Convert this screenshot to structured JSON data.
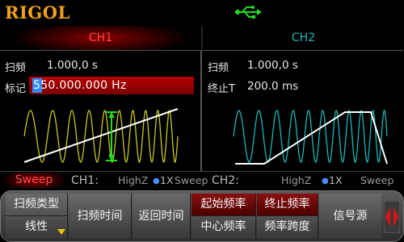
{
  "header": {
    "brand": "RIGOL",
    "usb_icon": "usb-icon"
  },
  "tabs": [
    {
      "label": "CH1",
      "active": true,
      "color": "#ff4444"
    },
    {
      "label": "CH2",
      "active": false,
      "color": "#19b7b7"
    }
  ],
  "ch1": {
    "rows": [
      {
        "label": "扫频",
        "value": "1.000,0 s"
      },
      {
        "label": "标记",
        "value": "550.000.000 Hz"
      }
    ],
    "waveform_color": "#c8c81e"
  },
  "ch2": {
    "rows": [
      {
        "label": "扫频",
        "value": "1.000,0 s"
      },
      {
        "label": "终止T",
        "value": "200.0 ms"
      }
    ],
    "waveform_color": "#19b7b7"
  },
  "status": {
    "mode": "Sweep",
    "ch1_label": "CH1:",
    "ch1_load": "HighZ",
    "ch1_gain": "1X",
    "ch1_mode": "Sweep",
    "ch2_label": "CH2:",
    "ch2_load": "HighZ",
    "ch2_gain": "1X",
    "ch2_mode": "Sweep"
  },
  "menu": {
    "sweep_type_label": "扫频类型",
    "sweep_type_value": "线性",
    "sweep_time": "扫频时间",
    "return_time": "返回时间",
    "start_freq": "起始频率",
    "center_freq": "中心频率",
    "stop_freq": "终止频率",
    "freq_span": "频率跨度",
    "source": "信号源"
  }
}
